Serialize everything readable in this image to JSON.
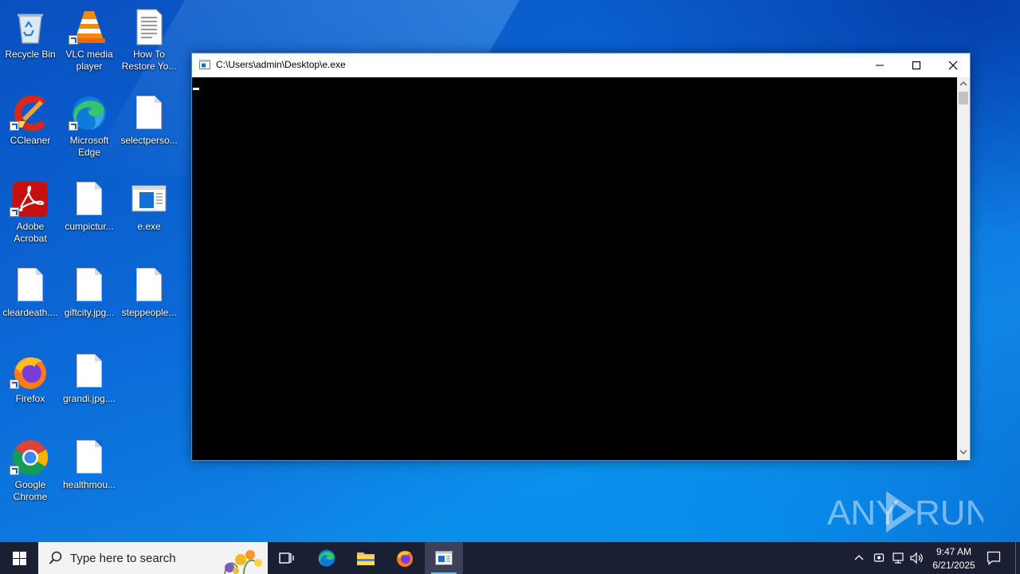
{
  "desktop": {
    "icons": [
      {
        "label": "Recycle Bin",
        "icon": "recycle-bin-icon"
      },
      {
        "label": "VLC media player",
        "icon": "vlc-icon"
      },
      {
        "label": "How To Restore Yo...",
        "icon": "text-document-icon"
      },
      {
        "label": "CCleaner",
        "icon": "ccleaner-icon"
      },
      {
        "label": "Microsoft Edge",
        "icon": "edge-icon"
      },
      {
        "label": "selectperso...",
        "icon": "file-icon"
      },
      {
        "label": "Adobe Acrobat",
        "icon": "acrobat-icon"
      },
      {
        "label": "cumpictur...",
        "icon": "file-icon"
      },
      {
        "label": "e.exe",
        "icon": "exe-icon"
      },
      {
        "label": "cleardeath....",
        "icon": "file-icon"
      },
      {
        "label": "giftcity.jpg...",
        "icon": "file-icon"
      },
      {
        "label": "steppeople...",
        "icon": "file-icon"
      },
      {
        "label": "Firefox",
        "icon": "firefox-icon"
      },
      {
        "label": "grandi.jpg....",
        "icon": "file-icon"
      },
      {
        "label": "Google Chrome",
        "icon": "chrome-icon"
      },
      {
        "label": "healthmou...",
        "icon": "file-icon"
      }
    ]
  },
  "window": {
    "title": "C:\\Users\\admin\\Desktop\\e.exe",
    "console_bg": "#000000"
  },
  "watermark": {
    "text_left": "ANY",
    "text_right": "RUN"
  },
  "taskbar": {
    "search_placeholder": "Type here to search",
    "apps": [
      "task-view-icon",
      "edge-icon",
      "file-explorer-icon",
      "firefox-icon",
      "console-app-icon"
    ],
    "clock_time": "9:47 AM",
    "clock_date": "6/21/2025"
  },
  "colors": {
    "taskbar": "#1a1f33",
    "accent": "#76b9ed"
  }
}
